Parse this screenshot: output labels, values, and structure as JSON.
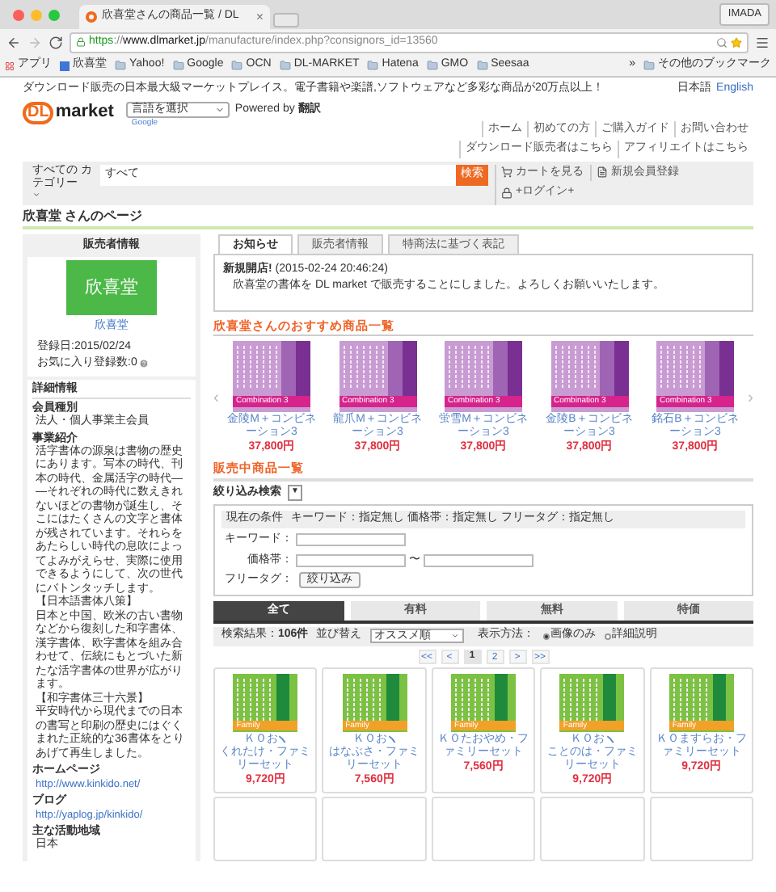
{
  "browser": {
    "tab_title": "欣喜堂さんの商品一覧 / DL",
    "tab_close": "×",
    "profile": "IMADA",
    "url": {
      "scheme": "https",
      "host": "://www.dlmarket.jp",
      "path": "/manufacture/index.php?consignors_id=13560"
    },
    "bookmarks": [
      {
        "label": "アプリ",
        "kind": "apps"
      },
      {
        "label": "欣喜堂",
        "kind": "page"
      },
      {
        "label": "Yahoo!",
        "kind": "folder"
      },
      {
        "label": "Google",
        "kind": "folder"
      },
      {
        "label": "OCN",
        "kind": "folder"
      },
      {
        "label": "DL-MARKET",
        "kind": "folder"
      },
      {
        "label": "Hatena",
        "kind": "folder"
      },
      {
        "label": "GMO",
        "kind": "folder"
      },
      {
        "label": "Seesaa",
        "kind": "folder"
      }
    ],
    "bookmarks_overflow": "»",
    "other_bookmarks": "その他のブックマーク"
  },
  "header": {
    "tagline": "ダウンロード販売の日本最大級マーケットプレイス。電子書籍や楽譜,ソフトウェアなど多彩な商品が20万点以上！",
    "languages": [
      {
        "label": "日本語",
        "selected": true
      },
      {
        "label": "English",
        "selected": false
      }
    ],
    "logo": {
      "mark": "DL",
      "word": "market"
    },
    "language_select": "言語を選択",
    "powered_by": "Powered by",
    "translate": "翻訳",
    "google": "Google",
    "nav": [
      "ホーム",
      "初めての方",
      "ご購入ガイド",
      "お問い合わせ",
      "ダウンロード販売者はこちら",
      "アフィリエイトはこちら"
    ],
    "search": {
      "category_label": "すべての カテゴリー",
      "category_select": "すべて",
      "button": "検索"
    },
    "cart": "カートを見る",
    "register": "新規会員登録",
    "login": "+ログイン+"
  },
  "page_title": "欣喜堂 さんのページ",
  "sidebar": {
    "heading": "販売者情報",
    "logo_text": "欣喜堂",
    "name": "欣喜堂",
    "registered": "登録日:2015/02/24",
    "favorites": "お気に入り登録数:0",
    "details_heading": "詳細情報",
    "fields": [
      {
        "label": "会員種別",
        "kind": "text",
        "values": [
          "法人・個人事業主会員"
        ]
      },
      {
        "label": "事業紹介",
        "kind": "text",
        "values": [
          "活字書体の源泉は書物の歴史にあります。写本の時代、刊本の時代、金属活字の時代――それぞれの時代に数えきれないほどの書物が誕生し、そこにはたくさんの文字と書体が残されています。それらをあたらしい時代の息吹によってよみがえらせ、実際に使用できるようにして、次の世代にバトンタッチします。",
          "【日本語書体八策】",
          "日本と中国、欧米の古い書物などから復刻した和字書体、漢字書体、欧字書体を組み合わせて、伝統にもとづいた新たな活字書体の世界が広がります。",
          "【和字書体三十六景】",
          "平安時代から現代までの日本の書写と印刷の歴史にはぐくまれた正統的な36書体をとりあげて再生しました。"
        ]
      },
      {
        "label": "ホームページ",
        "kind": "link",
        "values": [
          "http://www.kinkido.net/"
        ]
      },
      {
        "label": "ブログ",
        "kind": "link",
        "values": [
          "http://yaplog.jp/kinkido/"
        ]
      },
      {
        "label": "主な活動地域",
        "kind": "text",
        "values": [
          "日本"
        ]
      }
    ]
  },
  "tabs": [
    {
      "label": "お知らせ",
      "selected": true
    },
    {
      "label": "販売者情報",
      "selected": false
    },
    {
      "label": "特商法に基づく表記",
      "selected": false
    }
  ],
  "notice": {
    "title": "新規開店!",
    "date": "(2015-02-24 20:46:24)",
    "body": "欣喜堂の書体を DL market で販売することにしました。よろしくお願いいたします。"
  },
  "recommended": {
    "heading": "欣喜堂さんのおすすめ商品一覧",
    "prev": "‹",
    "next": "›",
    "items": [
      {
        "badge": "Combination 3",
        "name": "金陵M＋コンビネーション3",
        "price": "37,800円"
      },
      {
        "badge": "Combination 3",
        "name": "龍爪M＋コンビネーション3",
        "price": "37,800円"
      },
      {
        "badge": "Combination 3",
        "name": "蛍雪M＋コンビネーション3",
        "price": "37,800円"
      },
      {
        "badge": "Combination 3",
        "name": "金陵B＋コンビネーション3",
        "price": "37,800円"
      },
      {
        "badge": "Combination 3",
        "name": "銘石B＋コンビネーション3",
        "price": "37,800円"
      }
    ]
  },
  "on_sale": {
    "heading": "販売中商品一覧",
    "filter_label": "絞り込み検索",
    "filter_toggle": "▼",
    "conditions_label": "現在の条件",
    "conditions": "キーワード：指定無し 価格帯：指定無し フリータグ：指定無し",
    "keyword_label": "キーワード：",
    "price_label": "価格帯：",
    "range_sep": "〜",
    "tag_label": "フリータグ：",
    "filter_button": "絞り込み"
  },
  "category_tabs": [
    {
      "label": "全て",
      "selected": true
    },
    {
      "label": "有料",
      "selected": false
    },
    {
      "label": "無料",
      "selected": false
    },
    {
      "label": "特価",
      "selected": false
    }
  ],
  "results": {
    "label": "検索結果：",
    "count": "106件",
    "sort_label": "並び替え",
    "sort_select": "オススメ順",
    "view_label": "表示方法：",
    "view_options": [
      {
        "label": "画像のみ",
        "selected": true
      },
      {
        "label": "詳細説明",
        "selected": false
      }
    ]
  },
  "pagination": [
    {
      "label": "<<",
      "selected": false
    },
    {
      "label": "<",
      "selected": false
    },
    {
      "label": "1",
      "selected": true
    },
    {
      "label": "2",
      "selected": false
    },
    {
      "label": ">",
      "selected": false
    },
    {
      "label": ">>",
      "selected": false
    }
  ],
  "products": [
    {
      "badge": "Family",
      "name_before_mark": "ＫＯお",
      "name_after_mark": "くれたけ・ファミリーセット",
      "price": "9,720円"
    },
    {
      "badge": "Family",
      "name_before_mark": "ＫＯお",
      "name_after_mark": "はなぶさ・ファミリーセット",
      "price": "7,560円"
    },
    {
      "badge": "Family",
      "name": "ＫＯたおやめ・ファミリーセット",
      "price": "7,560円"
    },
    {
      "badge": "Family",
      "name_before_mark": "ＫＯお",
      "name_after_mark": "ことのは・ファミリーセット",
      "price": "9,720円"
    },
    {
      "badge": "Family",
      "name": "ＫＯますらお・ファミリーセット",
      "price": "9,720円"
    }
  ]
}
